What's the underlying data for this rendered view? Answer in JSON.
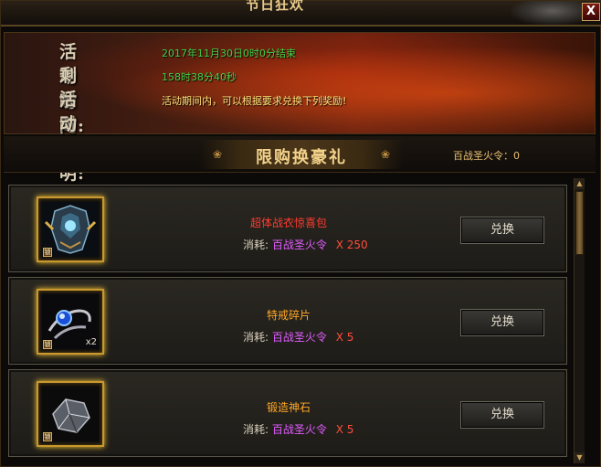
{
  "window": {
    "title": "节日狂欢",
    "close_label": "X"
  },
  "event": {
    "time_label": "活动时间:",
    "time_value": "2017年11月30日0时0分结束",
    "remaining_label": "剩余时间:",
    "remaining_value": "158时38分40秒",
    "desc_label": "活动说明:",
    "desc_value": "活动期间内，可以根据要求兑换下列奖励!"
  },
  "section": {
    "title": "限购换豪礼",
    "ornament_left": "❀",
    "ornament_right": "❀",
    "token_text": "百战圣火令：0"
  },
  "items": [
    {
      "name": "超体战衣惊喜包",
      "cost_label": "消耗:",
      "cost_item": "百战圣火令",
      "cost_qty": "X 250",
      "button": "兑换",
      "qty_badge": "",
      "lock": "锁"
    },
    {
      "name": "特戒碎片",
      "cost_label": "消耗:",
      "cost_item": "百战圣火令",
      "cost_qty": "X 5",
      "button": "兑换",
      "qty_badge": "x2",
      "lock": "锁"
    },
    {
      "name": "锻造神石",
      "cost_label": "消耗:",
      "cost_item": "百战圣火令",
      "cost_qty": "X 5",
      "button": "兑换",
      "qty_badge": "",
      "lock": "锁"
    }
  ],
  "scroll": {
    "up": "▲",
    "down": "▼"
  }
}
